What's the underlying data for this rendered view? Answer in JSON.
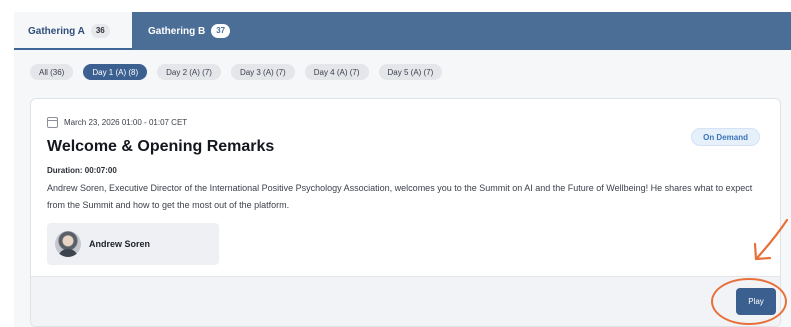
{
  "tabs": [
    {
      "label": "Gathering A",
      "count": "36"
    },
    {
      "label": "Gathering B",
      "count": "37"
    }
  ],
  "filters": [
    {
      "label": "All (36)",
      "active": false
    },
    {
      "label": "Day 1 (A) (8)",
      "active": true
    },
    {
      "label": "Day 2 (A) (7)",
      "active": false
    },
    {
      "label": "Day 3 (A) (7)",
      "active": false
    },
    {
      "label": "Day 4 (A) (7)",
      "active": false
    },
    {
      "label": "Day 5 (A) (7)",
      "active": false
    }
  ],
  "session": {
    "date": "March 23, 2026 01:00 - 01:07 CET",
    "title": "Welcome & Opening Remarks",
    "badge": "On Demand",
    "duration": "Duration: 00:07:00",
    "description": "Andrew Soren, Executive Director of the International Positive Psychology Association, welcomes you to the Summit on AI and the Future of Wellbeing! He shares what to expect from the Summit and how to get the most out of the platform.",
    "speaker": "Andrew Soren",
    "play_label": "Play"
  },
  "colors": {
    "accent": "#3b5f8f",
    "annotation": "#e8703a"
  }
}
